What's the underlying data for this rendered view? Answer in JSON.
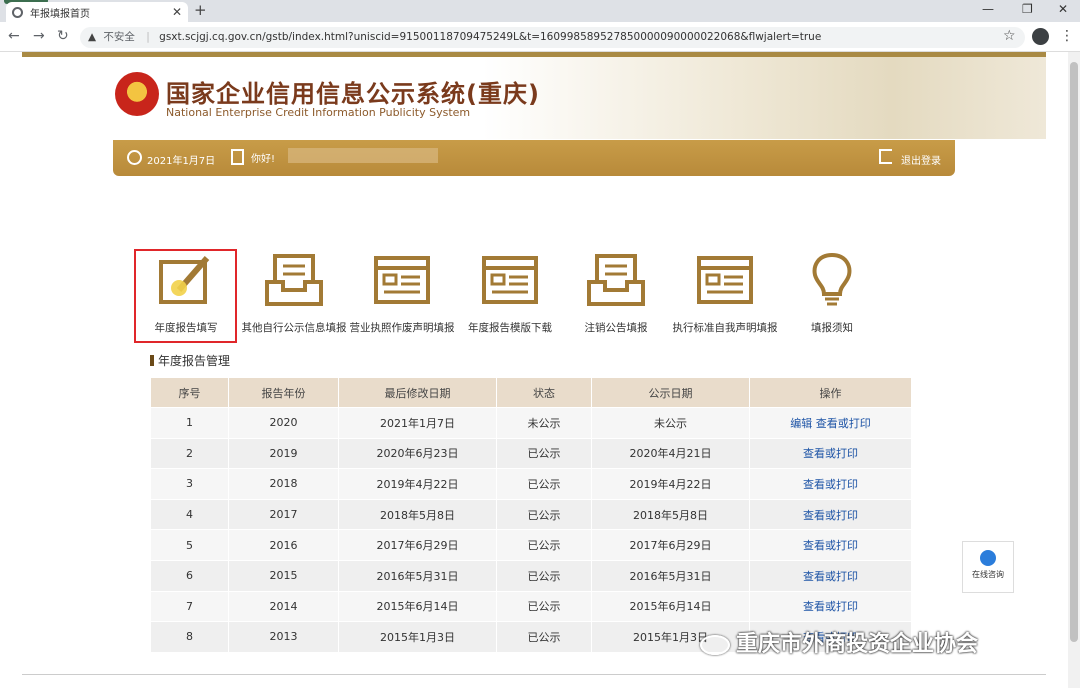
{
  "browser": {
    "tab_title": "年报填报首页",
    "insecure_label": "不安全",
    "url": "gsxt.scjgj.cq.gov.cn/gstb/index.html?uniscid=91500118709475249L&t=160998589527850000090000022068&flwjalert=true"
  },
  "header": {
    "title": "国家企业信用信息公示系统(重庆)",
    "subtitle": "National Enterprise Credit Information Publicity System"
  },
  "userbar": {
    "date": "2021年1月7日",
    "greeting": "你好!",
    "logout": "退出登录"
  },
  "functions": [
    {
      "label": "年度报告填写",
      "icon": "edit-icon"
    },
    {
      "label": "其他自行公示信息填报",
      "icon": "inbox-icon"
    },
    {
      "label": "营业执照作废声明填报",
      "icon": "form-icon"
    },
    {
      "label": "年度报告模版下载",
      "icon": "template-icon"
    },
    {
      "label": "注销公告填报",
      "icon": "inbox-icon"
    },
    {
      "label": "执行标准自我声明填报",
      "icon": "form-icon"
    },
    {
      "label": "填报须知",
      "icon": "lightbulb-icon"
    }
  ],
  "section_title": "年度报告管理",
  "table": {
    "headers": [
      "序号",
      "报告年份",
      "最后修改日期",
      "状态",
      "公示日期",
      "操作"
    ],
    "rows": [
      {
        "no": "1",
        "year": "2020",
        "modified": "2021年1月7日",
        "status": "未公示",
        "publish": "未公示",
        "edit": "编辑",
        "view": "查看或打印"
      },
      {
        "no": "2",
        "year": "2019",
        "modified": "2020年6月23日",
        "status": "已公示",
        "publish": "2020年4月21日",
        "view": "查看或打印"
      },
      {
        "no": "3",
        "year": "2018",
        "modified": "2019年4月22日",
        "status": "已公示",
        "publish": "2019年4月22日",
        "view": "查看或打印"
      },
      {
        "no": "4",
        "year": "2017",
        "modified": "2018年5月8日",
        "status": "已公示",
        "publish": "2018年5月8日",
        "view": "查看或打印"
      },
      {
        "no": "5",
        "year": "2016",
        "modified": "2017年6月29日",
        "status": "已公示",
        "publish": "2017年6月29日",
        "view": "查看或打印"
      },
      {
        "no": "6",
        "year": "2015",
        "modified": "2016年5月31日",
        "status": "已公示",
        "publish": "2016年5月31日",
        "view": "查看或打印"
      },
      {
        "no": "7",
        "year": "2014",
        "modified": "2015年6月14日",
        "status": "已公示",
        "publish": "2015年6月14日",
        "view": "查看或打印"
      },
      {
        "no": "8",
        "year": "2013",
        "modified": "2015年1月3日",
        "status": "已公示",
        "publish": "2015年1月3日",
        "view": "查看或打印"
      }
    ]
  },
  "online": {
    "label": "在线咨询"
  },
  "watermark": "重庆市外商投资企业协会",
  "colors": {
    "accent": "#b88a3a",
    "title": "#7a3a1c",
    "link": "#1e54a6",
    "highlight": "#e0262a"
  }
}
